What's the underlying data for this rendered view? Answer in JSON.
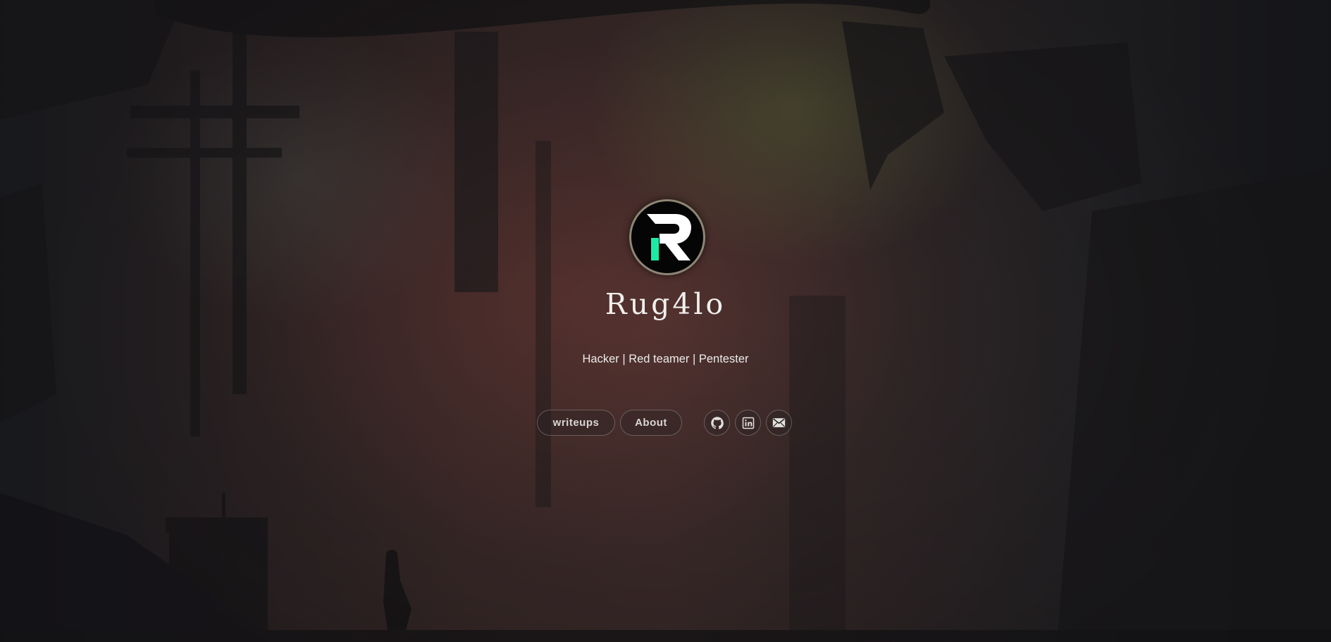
{
  "profile": {
    "name": "Rug4lo",
    "tagline": "Hacker | Red teamer | Pentester",
    "logo_letter": "R",
    "logo_accent_color": "#1de9a6"
  },
  "nav": {
    "items": [
      {
        "label": "writeups"
      },
      {
        "label": "About"
      }
    ]
  },
  "social": {
    "links": [
      {
        "icon": "github-icon"
      },
      {
        "icon": "linkedin-icon"
      },
      {
        "icon": "email-icon"
      }
    ]
  },
  "colors": {
    "text": "#f0efec",
    "button_border": "#8d8674",
    "background_dark": "#1c1e22",
    "background_warm": "#4d3532"
  }
}
